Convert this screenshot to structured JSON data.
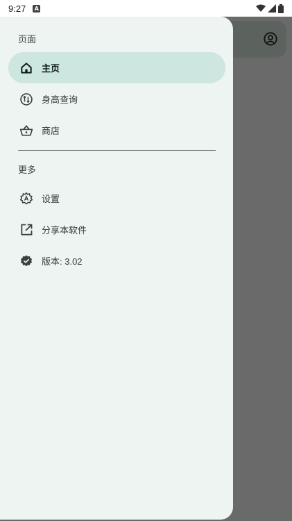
{
  "status": {
    "time": "9:27",
    "notification_icon": "a-badge-icon"
  },
  "drawer": {
    "sections": [
      {
        "header": "页面"
      },
      {
        "header": "更多"
      }
    ],
    "pages": [
      {
        "label": "主页",
        "icon": "home-icon",
        "active": true
      },
      {
        "label": "身高查询",
        "icon": "swap-vertical-icon",
        "active": false
      },
      {
        "label": "商店",
        "icon": "basket-icon",
        "active": false
      }
    ],
    "more": [
      {
        "label": "设置",
        "icon": "settings-gear-icon"
      },
      {
        "label": "分享本软件",
        "icon": "open-in-new-icon"
      },
      {
        "label": "版本: 3.02",
        "icon": "verified-badge-icon"
      }
    ]
  },
  "colors": {
    "drawer_bg": "#eef4f1",
    "active_item_bg": "#cde6df",
    "scrim": "#6a6a6a"
  }
}
